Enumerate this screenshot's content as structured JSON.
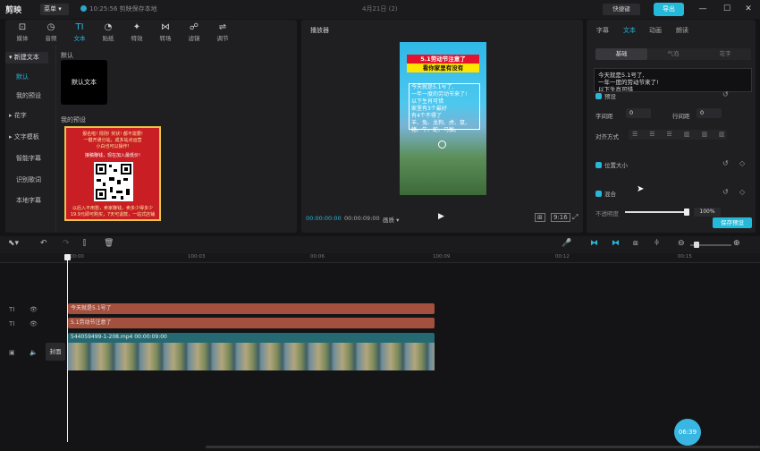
{
  "app": {
    "logo": "剪映",
    "menu": "菜单",
    "save_status": "10:25:56 剪映保存本地",
    "project": "4月21日 (2)",
    "shortcut": "快捷键",
    "export": "导出",
    "win_min": "—",
    "win_max": "☐",
    "win_close": "✕"
  },
  "tool_tabs": [
    {
      "label": "媒体",
      "icon": "⊡"
    },
    {
      "label": "音频",
      "icon": "◷"
    },
    {
      "label": "文本",
      "icon": "TI"
    },
    {
      "label": "贴纸",
      "icon": "◔"
    },
    {
      "label": "特效",
      "icon": "✦"
    },
    {
      "label": "转场",
      "icon": "⋈"
    },
    {
      "label": "滤镜",
      "icon": "☍"
    },
    {
      "label": "调节",
      "icon": "⇌"
    }
  ],
  "sidebar": [
    "新建文本",
    "默认",
    "我的预设",
    "花字",
    "文字模板",
    "智能字幕",
    "识别歌词",
    "本地字幕"
  ],
  "library": {
    "default_title": "默认",
    "default_card": "默认文本",
    "preset_title": "我的预设",
    "preset_lines": [
      "报名啦! 规则! 奖状! 都不需要!",
      "一键开通分站，成多站点运营",
      "小白也可以操作!",
      "接稿赚钱，现在加入最低价!",
      "以后入不用愁，卖家赚钱，卖多少得多少",
      "19.9元即可购买，7天可退款，一站式店铺"
    ]
  },
  "player": {
    "title": "播放器",
    "v_title1": "5.1劳动节注意了",
    "v_title2": "看你家里有没有",
    "v_body": "今天就是5.1号了,\n一年一度的劳动节来了!\n以下生肖可惜\n家里有3个最好\n有4个不得了\n羊、兔、龙狗、虎、鼠、\n猪、牛、蛇、马猴。",
    "time_current": "00:00:00:00",
    "time_total": "00:00:09:00",
    "quality": "画质",
    "play": "▶",
    "ratio": "9:16"
  },
  "props": {
    "tabs": [
      "字幕",
      "文本",
      "动画",
      "朗读"
    ],
    "subtabs": [
      "基础",
      "气泡",
      "花字"
    ],
    "editor_text": "今天就是5.1号了,\n一年一度的劳动节来了!\n以下生肖可惜",
    "preset_row": "预设",
    "letter_spacing": "字间距",
    "letter_value": "0",
    "line_spacing": "行间距",
    "line_value": "0",
    "align": "对齐方式",
    "pos_size": "位置大小",
    "blend": "混合",
    "opacity": "不透明度",
    "opacity_value": "100%",
    "save_preset": "保存预设"
  },
  "timeline": {
    "ticks": [
      "00:00",
      "100:03",
      "00:06",
      "100:09",
      "00:12",
      "00:15"
    ],
    "clip1": "今天就是5.1号了",
    "clip2": "5.1劳动节注意了",
    "video_label": "544059499-1-208.mp4    00:00:09:00",
    "cover": "封面",
    "fab": "06:39"
  }
}
